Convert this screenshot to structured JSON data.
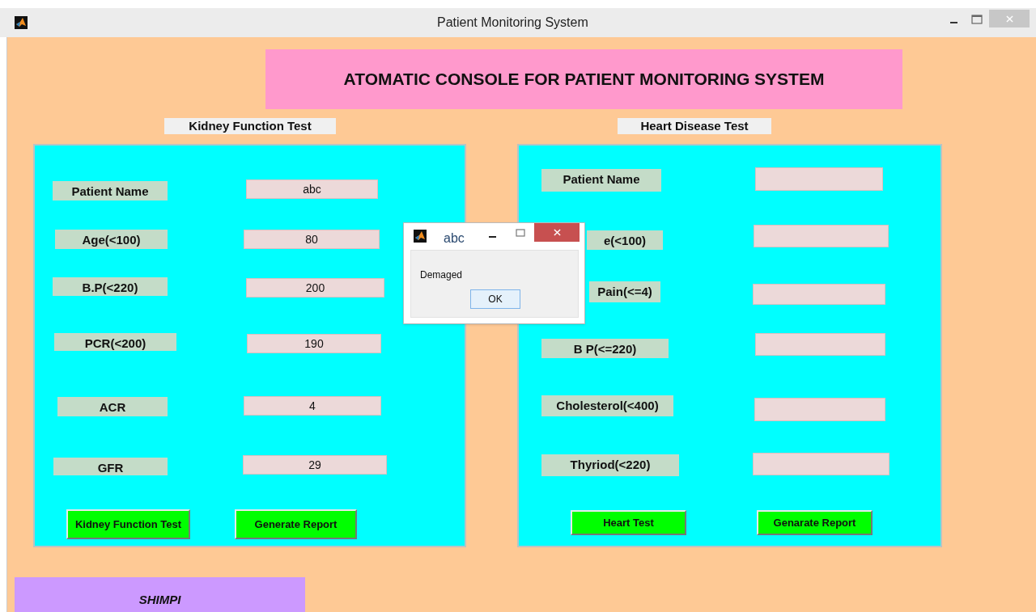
{
  "window": {
    "title": "Patient Monitoring System"
  },
  "banner": "ATOMATIC CONSOLE FOR PATIENT MONITORING SYSTEM",
  "kidney_panel": {
    "title": "Kidney Function Test",
    "rows": [
      {
        "label": "Patient Name",
        "value": "abc"
      },
      {
        "label": "Age(<100)",
        "value": "80"
      },
      {
        "label": "B.P(<220)",
        "value": "200"
      },
      {
        "label": "PCR(<200)",
        "value": "190"
      },
      {
        "label": "ACR",
        "value": "4"
      },
      {
        "label": "GFR",
        "value": "29"
      }
    ],
    "buttons": [
      "Kidney Function Test",
      "Generate Report"
    ]
  },
  "heart_panel": {
    "title": "Heart Disease Test",
    "rows": [
      {
        "label": "Patient Name"
      },
      {
        "label": "e(<100)"
      },
      {
        "label": "Pain(<=4)"
      },
      {
        "label": "B P(<=220)"
      },
      {
        "label": "Cholesterol(<400)"
      },
      {
        "label": "Thyriod(<220)"
      }
    ],
    "buttons": [
      "Heart Test",
      "Genarate Report"
    ]
  },
  "footer": "SHIMPI",
  "dialog": {
    "title": "abc",
    "message": "Demaged",
    "button": "OK"
  }
}
